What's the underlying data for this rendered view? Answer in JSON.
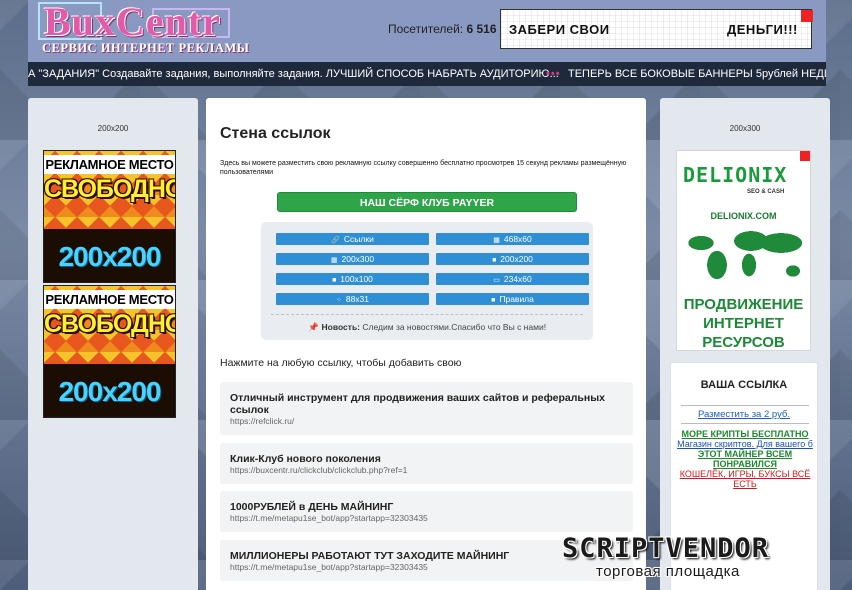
{
  "header": {
    "logo_title": "BuxCentr",
    "logo_subtitle": "СЕРВИС ИНТЕРНЕТ РЕКЛАМЫ",
    "visitors_label": "Посетителей:",
    "visitors_count": "6 516",
    "banner_left": "ЗАБЕРИ СВОИ",
    "banner_right": "ДЕНЬГИ!!!"
  },
  "ticker": {
    "message_1": "А \"ЗАДАНИЯ\" Создавайте задания, выполняйте задания. ЛУЧШИЙ СПОСОБ НАБРАТЬ АУДИТОРИЮ...",
    "separator": "•••",
    "message_2": "ТЕПЕРЬ ВСЕ БОКОВЫЕ БАННЕРЫ 5рублей НЕДЕЛ"
  },
  "left_side": {
    "caption": "200x200",
    "promo_line1": "РЕКЛАМНОЕ МЕСТО",
    "promo_line2": "СВОБОДНО",
    "promo_size": "200x200"
  },
  "right_side": {
    "caption": "200x300",
    "delionix": {
      "name": "DELIONIX",
      "tagline": "SEO & CASH",
      "url": "DELIONIX.COM",
      "slogan_1": "ПРОДВИЖЕНИЕ",
      "slogan_2": "ИНТЕРНЕТ",
      "slogan_3": "РЕСУРСОВ"
    },
    "your_link": {
      "heading": "ВАША ССЫЛКА",
      "place_link": "Разместить за 2 руб.",
      "ads": [
        {
          "text": "МОРЕ КРИПТЫ БЕСПЛАТНО",
          "color": "#1a8a2a"
        },
        {
          "text": "Магазин скриптов. Для вашего б",
          "color": "#1a4fc4"
        },
        {
          "text": "ЭТОТ МАЙНЕР ВСЕМ ПОНРАВИЛСЯ",
          "color": "#1a8a2a"
        },
        {
          "text": "КОШЕЛЁК, ИГРЫ, БУКСЫ ВСЁ ЕСТЬ",
          "color": "#d01818"
        }
      ]
    }
  },
  "main": {
    "title": "Стена ссылок",
    "description": "Здесь вы можете разместить свою рекламную ссылку совершенно бесплатно просмотрев 15 секунд рекламы размещённую пользователями",
    "payyer_button": "НАШ СЁРФ КЛУБ PAYYER",
    "grid_buttons": [
      {
        "icon": "link-icon",
        "glyph": "🔗",
        "label": "Ссылки"
      },
      {
        "icon": "image-icon",
        "glyph": "▦",
        "label": "468x60"
      },
      {
        "icon": "image-icon",
        "glyph": "▦",
        "label": "200x300"
      },
      {
        "icon": "square-icon",
        "glyph": "■",
        "label": "200x200"
      },
      {
        "icon": "square-icon",
        "glyph": "■",
        "label": "100x100"
      },
      {
        "icon": "rect-icon",
        "glyph": "▭",
        "label": "234x60"
      },
      {
        "icon": "grid-icon",
        "glyph": "⁘",
        "label": "88x31"
      },
      {
        "icon": "square-icon",
        "glyph": "■",
        "label": "Правила"
      }
    ],
    "news_label": "Новость:",
    "news_text": "Следим за новостями.Спасибо что Вы с нами!",
    "click_hint": "Нажмите на любую ссылку, чтобы добавить свою",
    "links": [
      {
        "title": "Отличный инструмент для продвижения ваших сайтов и реферальных ссылок",
        "url": "https://refclick.ru/"
      },
      {
        "title": "Клик-Клуб нового поколения",
        "url": "https://buxcentr.ru/clickclub/clickclub.php?ref=1"
      },
      {
        "title": "1000РУБЛЕЙ в ДЕНЬ МАЙНИНГ",
        "url": "https://t.me/metapu1se_bot/app?startapp=32303435"
      },
      {
        "title": "МИЛЛИОНЕРЫ РАБОТАЮТ ТУТ ЗАХОДИТЕ МАЙНИНГ",
        "url": "https://t.me/metapu1se_bot/app?startapp=32303435"
      }
    ]
  },
  "watermark": {
    "title": "SCRIPTVENDOR",
    "subtitle": "торговая площадка"
  }
}
